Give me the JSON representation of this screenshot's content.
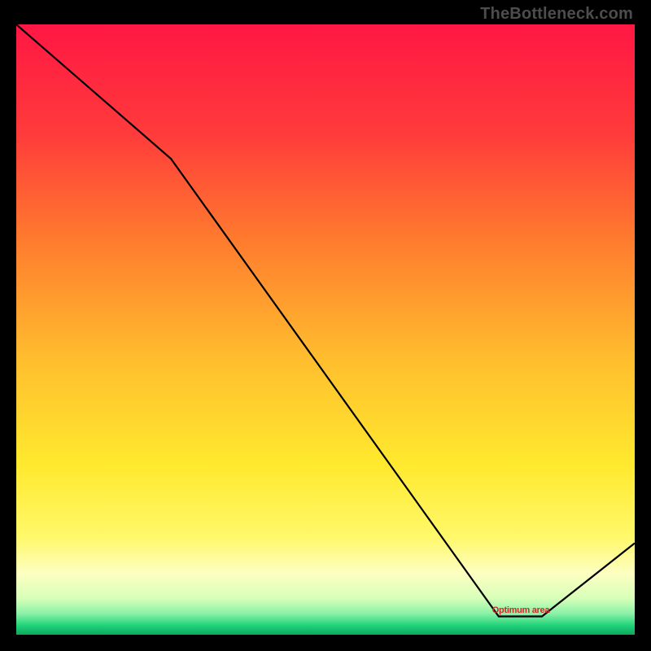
{
  "watermark": "TheBottleneck.com",
  "chart_data": {
    "type": "line",
    "title": "",
    "xlabel": "",
    "ylabel": "",
    "xlim": [
      0,
      100
    ],
    "ylim": [
      0,
      100
    ],
    "x": [
      0,
      25,
      78,
      85,
      100
    ],
    "values": [
      100,
      78,
      3,
      3,
      15
    ],
    "series_color": "#000000",
    "point_label": {
      "text": "Optimum area",
      "x": 78,
      "y": 3
    },
    "gradient_stops": [
      {
        "offset": 0.0,
        "color": "#ff1744"
      },
      {
        "offset": 0.18,
        "color": "#ff3b3b"
      },
      {
        "offset": 0.35,
        "color": "#ff7a2e"
      },
      {
        "offset": 0.55,
        "color": "#ffbe2e"
      },
      {
        "offset": 0.72,
        "color": "#ffe92e"
      },
      {
        "offset": 0.84,
        "color": "#fff86a"
      },
      {
        "offset": 0.9,
        "color": "#fdffc2"
      },
      {
        "offset": 0.94,
        "color": "#d8ffb8"
      },
      {
        "offset": 0.965,
        "color": "#8cf2a8"
      },
      {
        "offset": 0.985,
        "color": "#20d27a"
      },
      {
        "offset": 1.0,
        "color": "#0aa85a"
      }
    ]
  }
}
